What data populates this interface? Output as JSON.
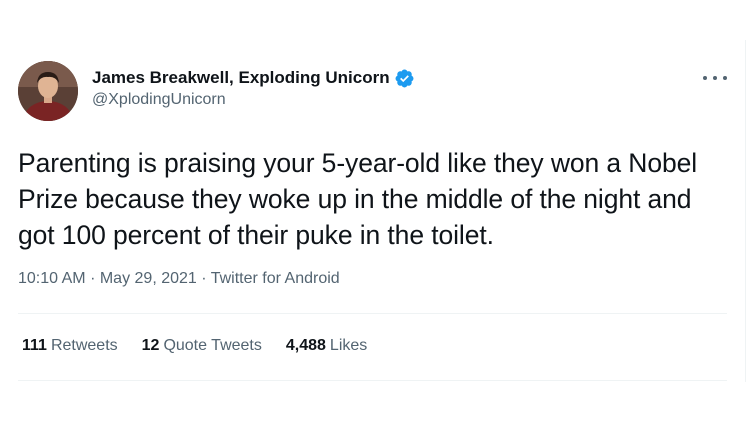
{
  "author": {
    "display_name": "James Breakwell, Exploding Unicorn",
    "handle": "@XplodingUnicorn",
    "verified": true
  },
  "tweet": {
    "text": "Parenting is praising your 5-year-old like they won a Nobel Prize because they woke up in the middle of the night and got 100 percent of their puke in the toilet.",
    "time": "10:10 AM",
    "separator": "·",
    "date": "May 29, 2021",
    "source": "Twitter for Android"
  },
  "stats": {
    "retweets": {
      "count": "111",
      "label": "Retweets"
    },
    "quote_tweets": {
      "count": "12",
      "label": "Quote Tweets"
    },
    "likes": {
      "count": "4,488",
      "label": "Likes"
    }
  },
  "icons": {
    "verified": "verified-badge-icon",
    "more": "more-options-icon"
  },
  "colors": {
    "verified_blue": "#1d9bf0",
    "secondary_text": "#536471",
    "primary_text": "#0f1419",
    "divider": "#eff3f4"
  }
}
